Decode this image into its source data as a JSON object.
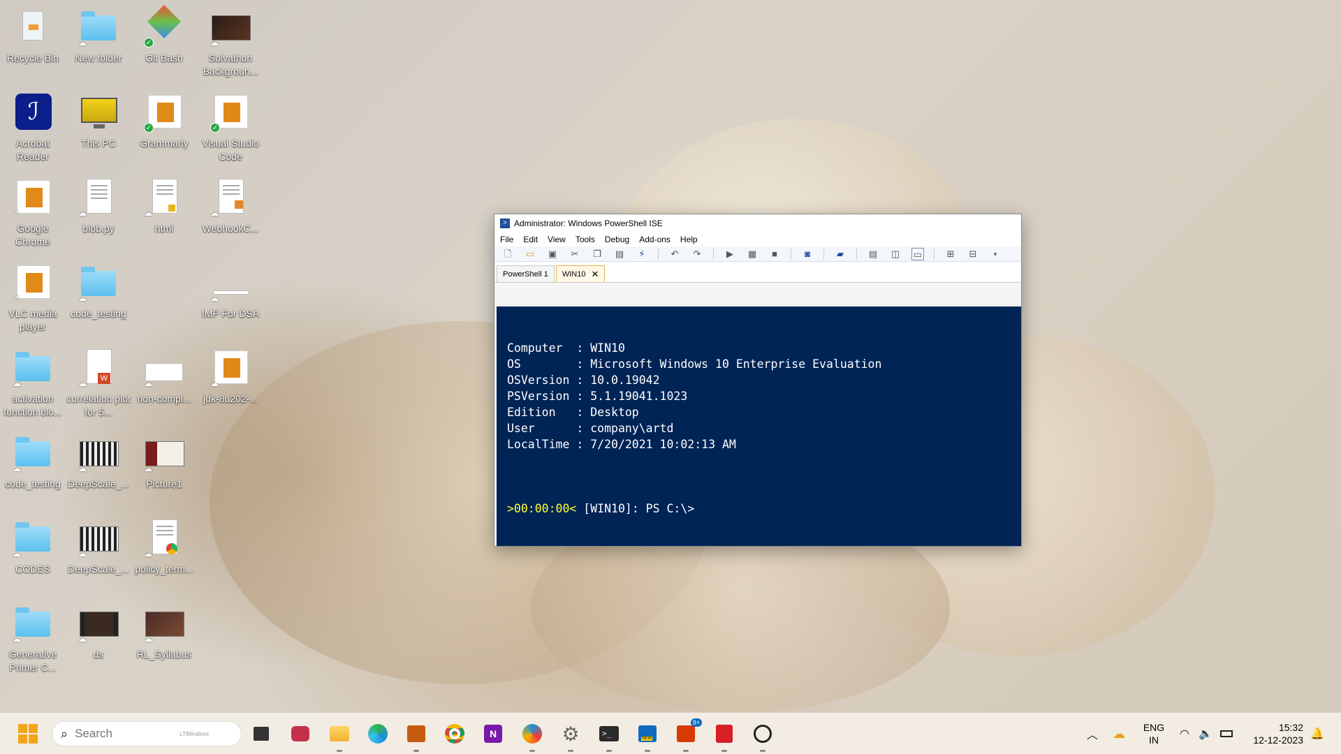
{
  "desktop_icons": [
    {
      "label": "Recycle Bin",
      "icon": "recycle-bin-icon"
    },
    {
      "label": "New folder",
      "icon": "folder-icon"
    },
    {
      "label": "Git Bash",
      "icon": "git-bash-icon"
    },
    {
      "label": "Solvathon Backgroun...",
      "icon": "image-icon"
    },
    {
      "label": "Acrobat Reader",
      "icon": "acrobat-icon"
    },
    {
      "label": "This PC",
      "icon": "monitor-icon"
    },
    {
      "label": "Grammarly",
      "icon": "app-icon"
    },
    {
      "label": "Visual Studio Code",
      "icon": "app-icon"
    },
    {
      "label": "Google Chrome",
      "icon": "app-icon"
    },
    {
      "label": "blob.py",
      "icon": "document-icon"
    },
    {
      "label": "html",
      "icon": "document-icon"
    },
    {
      "label": "WebhookC...",
      "icon": "document-icon"
    },
    {
      "label": "VLC media player",
      "icon": "app-icon"
    },
    {
      "label": "code_testing",
      "icon": "folder-icon"
    },
    {
      "label": "IMP For DSA",
      "icon": "document-icon"
    },
    {
      "label": "activation function blo...",
      "icon": "folder-icon"
    },
    {
      "label": "correlation plot for 5...",
      "icon": "word-document-icon"
    },
    {
      "label": "non-compl...",
      "icon": "document-icon"
    },
    {
      "label": "jdk-8u202-...",
      "icon": "app-icon"
    },
    {
      "label": "code_testing",
      "icon": "folder-icon"
    },
    {
      "label": "DeepScale_...",
      "icon": "video-icon"
    },
    {
      "label": "Picture1",
      "icon": "image-icon"
    },
    {
      "label": "CODES",
      "icon": "folder-icon"
    },
    {
      "label": "DeepScale_...",
      "icon": "video-icon"
    },
    {
      "label": "policy_term...",
      "icon": "document-icon"
    },
    {
      "label": "Generative Primer C...",
      "icon": "folder-icon"
    },
    {
      "label": "ds",
      "icon": "video-icon"
    },
    {
      "label": "RL_Syllabus",
      "icon": "image-icon"
    }
  ],
  "window": {
    "title": "Administrator: Windows PowerShell ISE",
    "menu": [
      "File",
      "Edit",
      "View",
      "Tools",
      "Debug",
      "Add-ons",
      "Help"
    ],
    "tabs": [
      {
        "label": "PowerShell 1",
        "active": false
      },
      {
        "label": "WIN10",
        "active": true,
        "close": "✕"
      }
    ],
    "console_lines": [
      "Computer  : WIN10",
      "OS        : Microsoft Windows 10 Enterprise Evaluation",
      "OSVersion : 10.0.19042",
      "PSVersion : 5.1.19041.1023",
      "Edition   : Desktop",
      "User      : company\\artd",
      "LocalTime : 7/20/2021 10:02:13 AM"
    ],
    "prompt_timer": ">00:00:00<",
    "prompt_text": " [WIN10]: PS C:\\>",
    "colors": {
      "console_bg": "#012456",
      "timer": "#ffff3a"
    }
  },
  "taskbar": {
    "search_placeholder": "Search",
    "search_brand": "LTIMindtree",
    "apps": [
      "task-view-icon",
      "teams-icon",
      "file-explorer-icon",
      "edge-icon",
      "store-icon",
      "chrome-icon",
      "onenote-icon",
      "snipping-tool-icon",
      "settings-icon",
      "terminal-icon",
      "outlook-icon",
      "office-icon",
      "acrobat-icon",
      "clock-icon"
    ],
    "badges": {
      "office": "9+",
      "new": "NEW"
    },
    "lang_top": "ENG",
    "lang_bottom": "IN",
    "time": "15:32",
    "date": "12-12-2023"
  }
}
